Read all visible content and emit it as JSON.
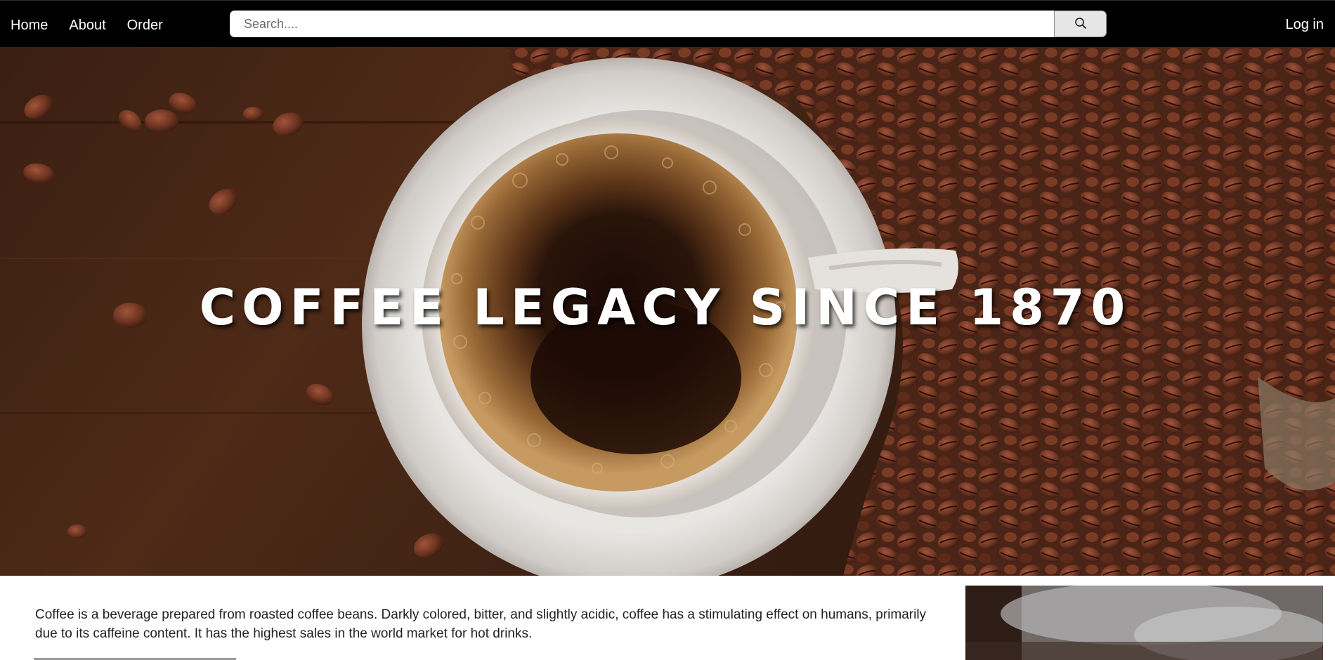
{
  "nav": {
    "links": [
      {
        "label": "Home"
      },
      {
        "label": "About"
      },
      {
        "label": "Order"
      }
    ],
    "login_label": "Log in"
  },
  "search": {
    "placeholder": "Search....",
    "value": "",
    "button_icon": "search-icon"
  },
  "hero": {
    "title": "COFFEE LEGACY SINCE 1870",
    "image": "coffee-cup-with-beans"
  },
  "intro": {
    "text": "Coffee is a beverage prepared from roasted coffee beans. Darkly colored, bitter, and slightly acidic, coffee has a stimulating effect on humans, primarily due to its caffeine content. It has the highest sales in the world market for hot drinks.",
    "side_image": "coffee-photo"
  },
  "colors": {
    "navbar": "#000000",
    "nav_text": "#ffffff",
    "search_button_bg": "#e6e6e6",
    "hero_title": "#ffffff"
  }
}
